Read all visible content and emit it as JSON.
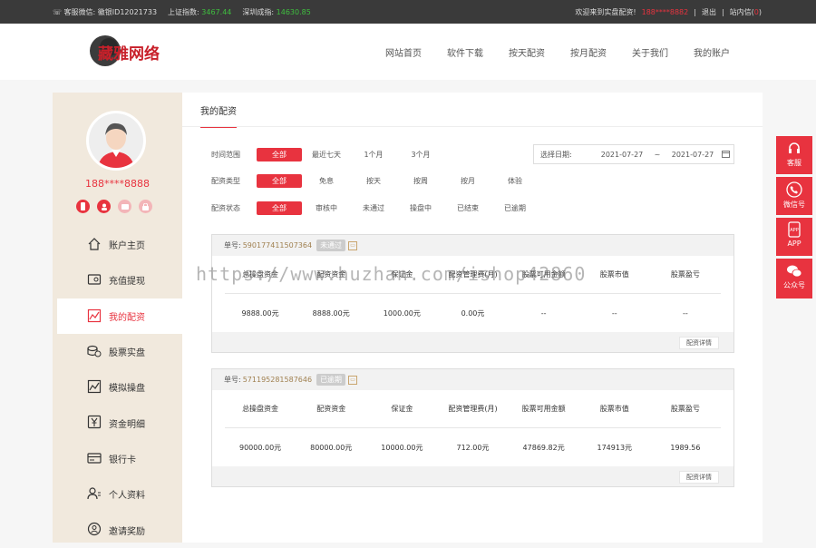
{
  "topbar": {
    "service_label": "客服微信:",
    "service_value": "徽银ID12021733",
    "sh_label": "上证指数:",
    "sh_value": "3467.44",
    "sz_label": "深圳成指:",
    "sz_value": "14630.85",
    "welcome": "欢迎来到实盘配资!",
    "user": "188****8882",
    "logout": "退出",
    "messages": "站内信",
    "msg_count": "0"
  },
  "logo": {
    "text": "藏雅网络"
  },
  "nav": [
    "网站首页",
    "软件下载",
    "按天配资",
    "按月配资",
    "关于我们",
    "我的账户"
  ],
  "sidebar": {
    "phone": "188****8888",
    "menu": [
      "账户主页",
      "充值提现",
      "我的配资",
      "股票实盘",
      "模拟操盘",
      "资金明细",
      "银行卡",
      "个人资料",
      "邀请奖励"
    ]
  },
  "main": {
    "title": "我的配资",
    "filters": {
      "time": {
        "label": "时间范围",
        "options": [
          "全部",
          "最近七天",
          "1个月",
          "3个月"
        ]
      },
      "type": {
        "label": "配资类型",
        "options": [
          "全部",
          "免息",
          "按天",
          "按周",
          "按月",
          "体验"
        ]
      },
      "status": {
        "label": "配资状态",
        "options": [
          "全部",
          "审核中",
          "未通过",
          "操盘中",
          "已结束",
          "已逾期"
        ]
      }
    },
    "date": {
      "label": "选择日期:",
      "start": "2021-07-27",
      "sep": "~",
      "end": "2021-07-27"
    },
    "columns": [
      "总操盘资金",
      "配资资金",
      "保证金",
      "配资管理费(月)",
      "股票可用金额",
      "股票市值",
      "股票盈亏"
    ],
    "orders": [
      {
        "label": "单号:",
        "number": "590177411507364",
        "status": "未通过",
        "values": [
          "9888.00元",
          "8888.00元",
          "1000.00元",
          "0.00元",
          "--",
          "--",
          "--"
        ],
        "detail": "配资详情"
      },
      {
        "label": "单号:",
        "number": "571195281587646",
        "status": "已逾期",
        "values": [
          "90000.00元",
          "80000.00元",
          "10000.00元",
          "712.00元",
          "47869.82元",
          "174913元",
          "1989.56"
        ],
        "detail": "配资详情"
      }
    ]
  },
  "right_float": [
    "客服",
    "微信号",
    "APP",
    "公众号"
  ],
  "app_icon_text": "APP",
  "watermark": "https://www.huzhan.com/ishop42860"
}
